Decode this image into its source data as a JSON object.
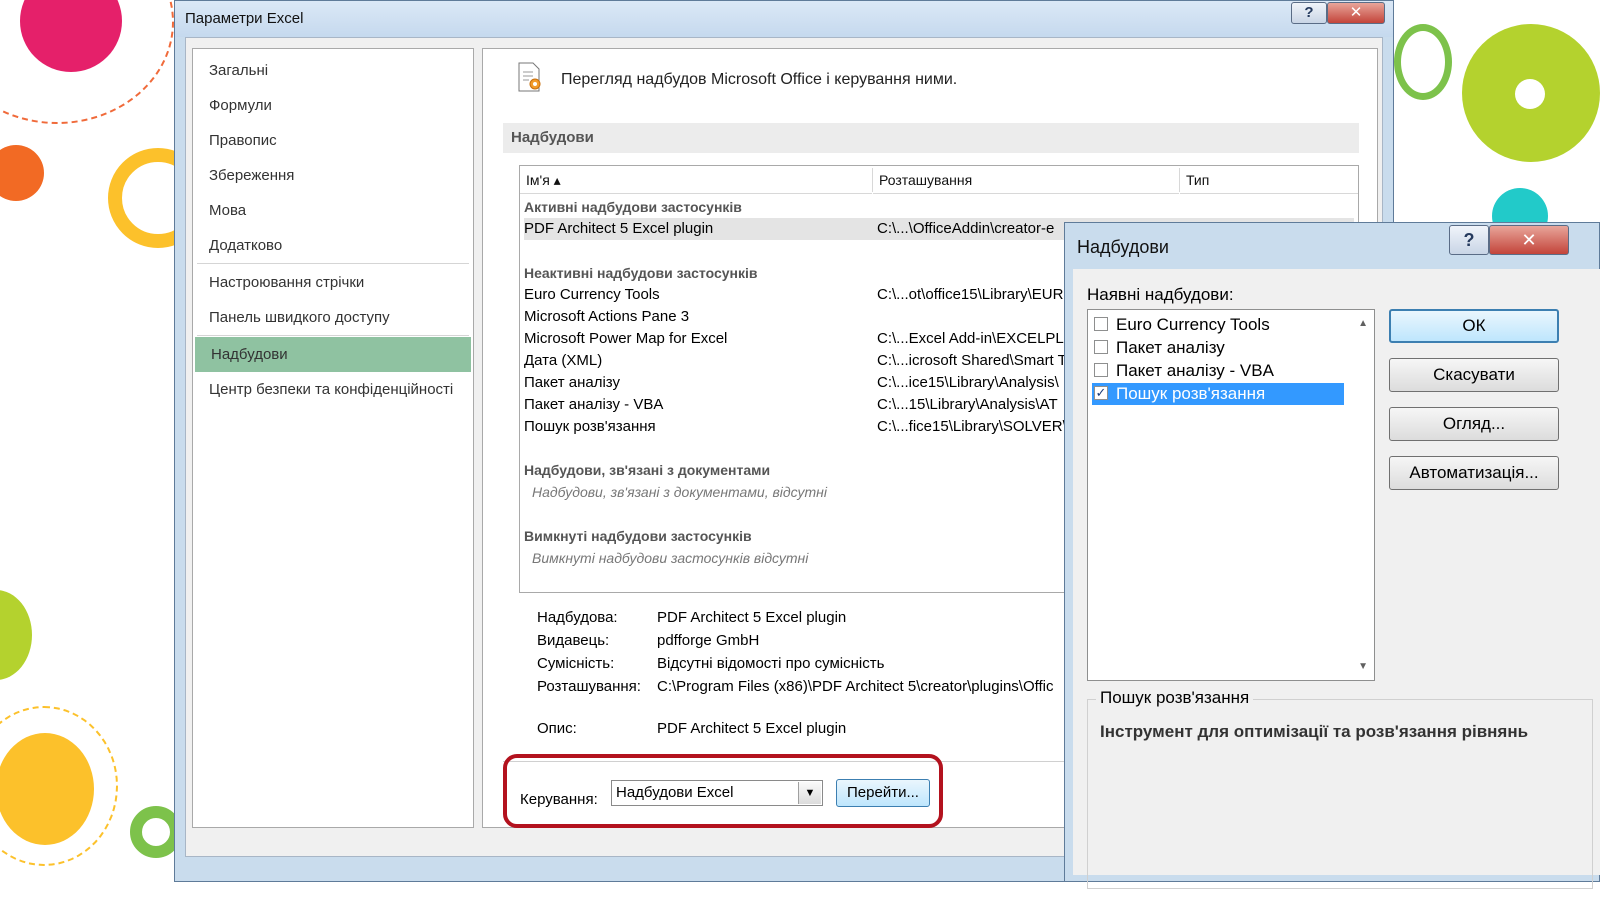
{
  "main_window": {
    "title": "Параметри Excel",
    "help_glyph": "?",
    "close_glyph": "✕"
  },
  "nav": {
    "items": [
      "Загальні",
      "Формули",
      "Правопис",
      "Збереження",
      "Мова",
      "Додатково",
      "Настроювання стрічки",
      "Панель швидкого доступу",
      "Надбудови",
      "Центр безпеки та конфіденційності"
    ],
    "active": "Надбудови"
  },
  "content": {
    "heading": "Перегляд надбудов Microsoft Office і керування ними.",
    "section": "Надбудови",
    "columns": {
      "name": "Ім'я ▴",
      "location": "Розташування",
      "type": "Тип"
    },
    "groups": {
      "active": "Активні надбудови застосунків",
      "inactive": "Неактивні надбудови застосунків",
      "documents": "Надбудови, зв'язані з документами",
      "disabled": "Вимкнуті надбудови застосунків"
    },
    "active_rows": [
      {
        "name": "PDF Architect 5 Excel plugin",
        "location": "C:\\...\\OfficeAddin\\creator-e"
      }
    ],
    "inactive_rows": [
      {
        "name": "Euro Currency Tools",
        "location": "C:\\...ot\\office15\\Library\\EUR"
      },
      {
        "name": "Microsoft Actions Pane 3",
        "location": ""
      },
      {
        "name": "Microsoft Power Map for Excel",
        "location": "C:\\...Excel Add-in\\EXCELPLU"
      },
      {
        "name": "Дата (XML)",
        "location": "C:\\...icrosoft Shared\\Smart T"
      },
      {
        "name": "Пакет аналізу",
        "location": "C:\\...ice15\\Library\\Analysis\\"
      },
      {
        "name": "Пакет аналізу - VBA",
        "location": "C:\\...15\\Library\\Analysis\\AT"
      },
      {
        "name": "Пошук розв'язання",
        "location": "C:\\...fice15\\Library\\SOLVER\\"
      }
    ],
    "documents_empty": "Надбудови, зв'язані з документами, відсутні",
    "disabled_empty": "Вимкнуті надбудови застосунків відсутні",
    "details": {
      "addin_label": "Надбудова:",
      "addin_value": "PDF Architect 5 Excel plugin",
      "publisher_label": "Видавець:",
      "publisher_value": "pdfforge GmbH",
      "compat_label": "Сумісність:",
      "compat_value": "Відсутні відомості про сумісність",
      "location_label": "Розташування:",
      "location_value": "C:\\Program Files (x86)\\PDF Architect 5\\creator\\plugins\\Offic",
      "desc_label": "Опис:",
      "desc_value": "PDF Architect 5 Excel plugin"
    },
    "manage_label": "Керування:",
    "manage_value": "Надбудови Excel",
    "go_button": "Перейти..."
  },
  "addins_dialog": {
    "title": "Надбудови",
    "available_label": "Наявні надбудови:",
    "items": [
      {
        "label": "Euro Currency Tools",
        "checked": false
      },
      {
        "label": "Пакет аналізу",
        "checked": false
      },
      {
        "label": "Пакет аналізу - VBA",
        "checked": false
      },
      {
        "label": "Пошук розв'язання",
        "checked": true
      }
    ],
    "buttons": {
      "ok": "ОК",
      "cancel": "Скасувати",
      "browse": "Огляд...",
      "automation": "Автоматизація..."
    },
    "desc_title": "Пошук розв'язання",
    "desc_text": "Інструмент для оптимізації та розв'язання рівнянь"
  },
  "colors": {
    "accent_nav": "#8fc2a1",
    "highlight": "#b3121e",
    "selection": "#3399ff"
  }
}
